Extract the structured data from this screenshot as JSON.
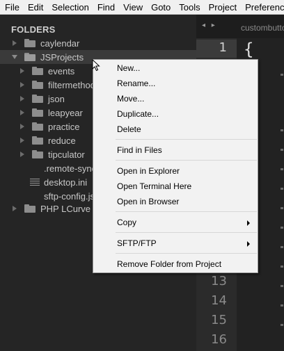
{
  "menubar": {
    "items": [
      "File",
      "Edit",
      "Selection",
      "Find",
      "View",
      "Goto",
      "Tools",
      "Project",
      "Preferences"
    ]
  },
  "sidebar": {
    "title": "FOLDERS",
    "items": [
      {
        "label": "caylendar",
        "type": "folder",
        "expanded": false
      },
      {
        "label": "JSProjects",
        "type": "folder",
        "expanded": true
      },
      {
        "label": "events",
        "type": "folder",
        "expanded": false
      },
      {
        "label": "filtermethod",
        "type": "folder",
        "expanded": false
      },
      {
        "label": "json",
        "type": "folder",
        "expanded": false
      },
      {
        "label": "leapyear",
        "type": "folder",
        "expanded": false
      },
      {
        "label": "practice",
        "type": "folder",
        "expanded": false
      },
      {
        "label": "reduce",
        "type": "folder",
        "expanded": false
      },
      {
        "label": "tipculator",
        "type": "folder",
        "expanded": false
      },
      {
        "label": ".remote-sync.",
        "type": "file"
      },
      {
        "label": "desktop.ini",
        "type": "file"
      },
      {
        "label": "sftp-config.jso",
        "type": "file"
      },
      {
        "label": "PHP LCurve",
        "type": "folder",
        "expanded": false
      }
    ]
  },
  "editor": {
    "tab": {
      "nav": "◂ ▸",
      "name": "custombutto"
    },
    "first_line_text": "{",
    "line_numbers": [
      "1",
      "13",
      "14",
      "15",
      "16"
    ]
  },
  "context_menu": {
    "items": [
      "New...",
      "Rename...",
      "Move...",
      "Duplicate...",
      "Delete",
      "Find in Files",
      "Open in Explorer",
      "Open Terminal Here",
      "Open in Browser",
      "Copy",
      "SFTP/FTP",
      "Remove Folder from Project"
    ]
  },
  "colors": {
    "sidebar_bg": "#252525",
    "editor_bg": "#222222",
    "menu_bg": "#f2f2f2"
  }
}
